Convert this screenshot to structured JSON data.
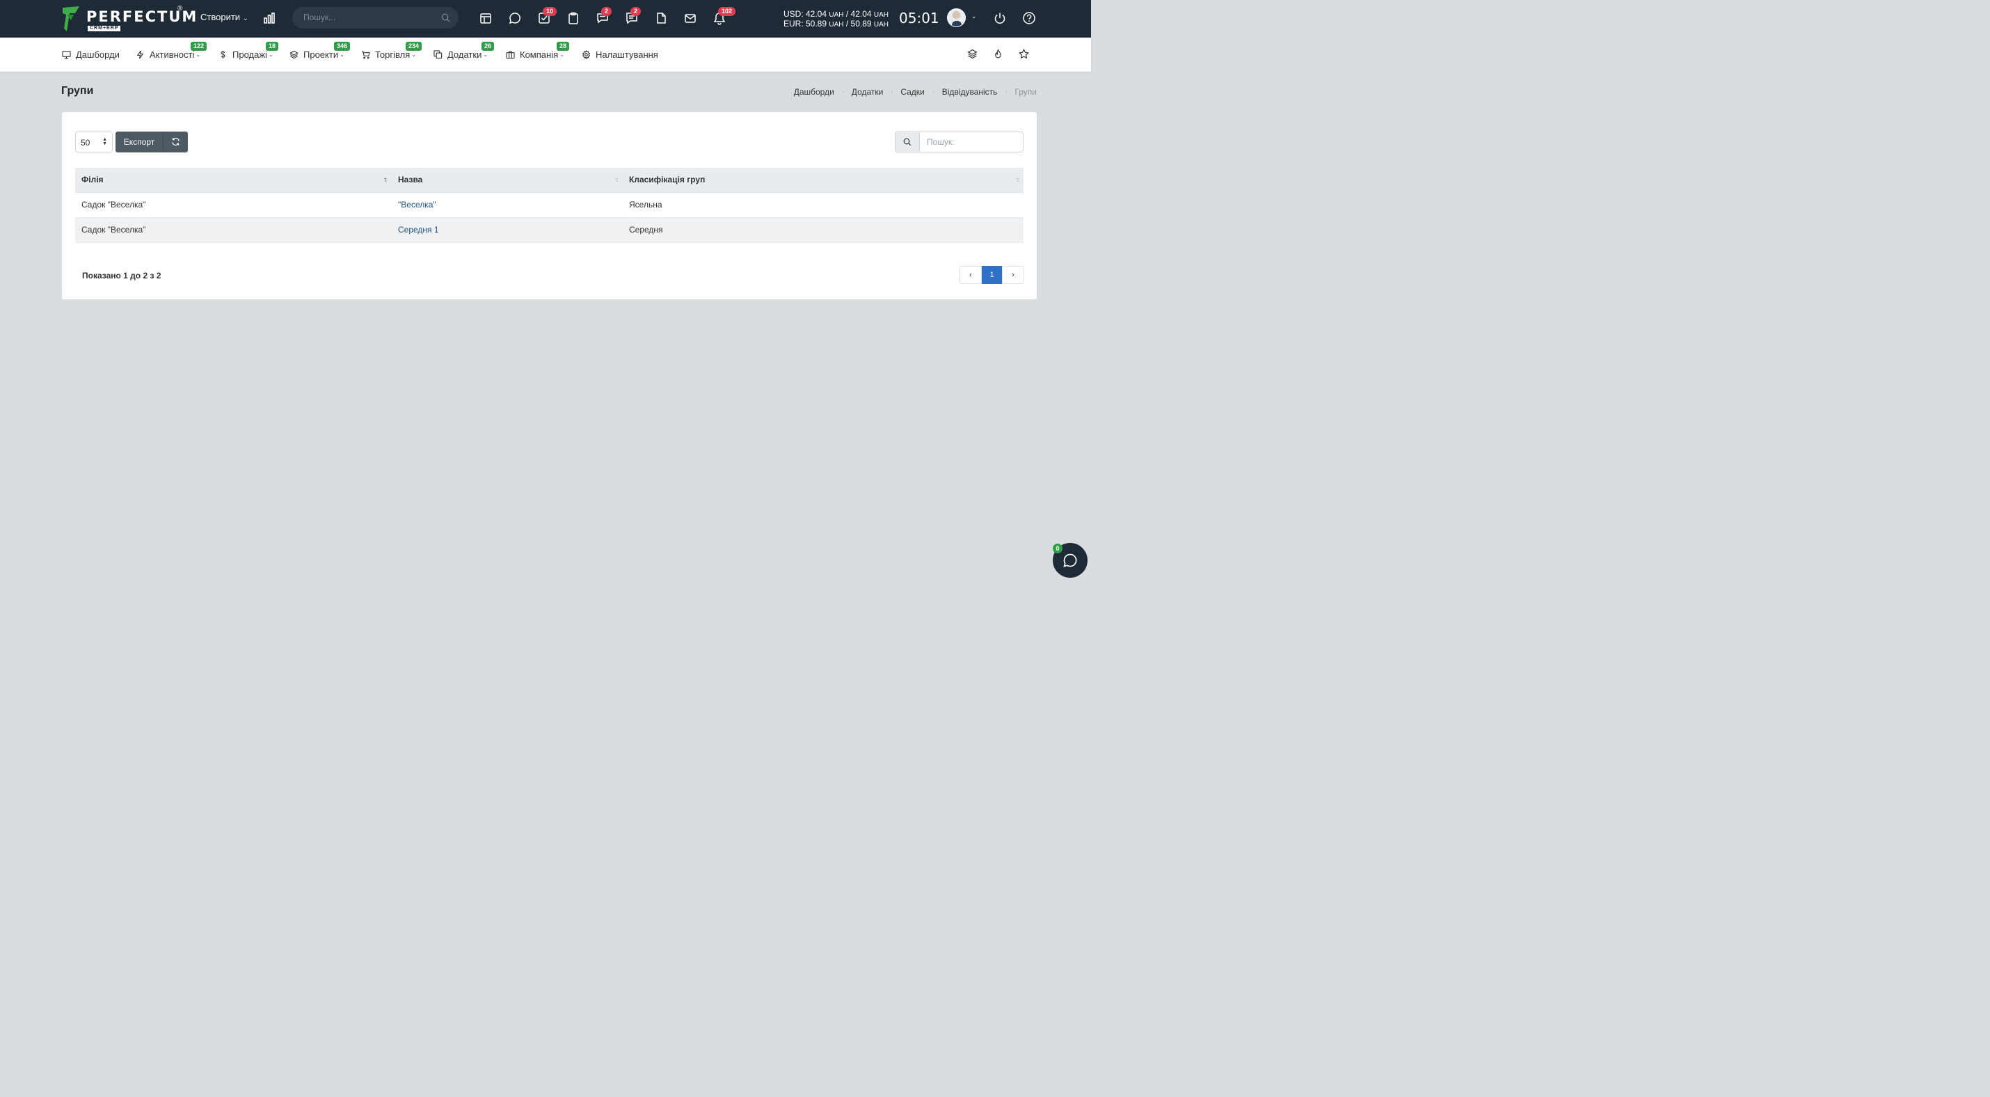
{
  "header": {
    "logo_text": "PERFECTUM",
    "logo_sub": "CRM+ERP",
    "logo_reg": "®",
    "create_label": "Створити",
    "search_placeholder": "Пошук...",
    "icons": [
      {
        "name": "calendar-icon",
        "badge": ""
      },
      {
        "name": "chat-icon",
        "badge": ""
      },
      {
        "name": "tasks-icon",
        "badge": "10"
      },
      {
        "name": "clipboard-icon",
        "badge": ""
      },
      {
        "name": "discussions-icon",
        "badge": "2"
      },
      {
        "name": "notes-icon",
        "badge": "2"
      },
      {
        "name": "file-icon",
        "badge": ""
      },
      {
        "name": "mail-icon",
        "badge": ""
      },
      {
        "name": "bell-icon",
        "badge": "102"
      }
    ],
    "usd_line": "USD: 42.04",
    "usd_mid": "/ 42.04",
    "eur_line": "EUR: 50.89",
    "eur_mid": "/ 50.89",
    "currency_unit": "UAH",
    "clock": "05:01"
  },
  "nav": {
    "items": [
      {
        "label": "Дашборди",
        "icon": "monitor-icon",
        "badge": ""
      },
      {
        "label": "Активності",
        "icon": "bolt-icon",
        "badge": "122"
      },
      {
        "label": "Продажі",
        "icon": "dollar-icon",
        "badge": "18"
      },
      {
        "label": "Проекти",
        "icon": "layers-icon",
        "badge": "346"
      },
      {
        "label": "Торгівля",
        "icon": "cart-icon",
        "badge": "234"
      },
      {
        "label": "Додатки",
        "icon": "copy-icon",
        "badge": "26"
      },
      {
        "label": "Компанія",
        "icon": "briefcase-icon",
        "badge": "28"
      },
      {
        "label": "Налаштування",
        "icon": "gear-icon",
        "badge": ""
      }
    ]
  },
  "page": {
    "title": "Групи",
    "breadcrumbs": [
      "Дашборди",
      "Додатки",
      "Садки",
      "Відвідуваність",
      "Групи"
    ]
  },
  "table_controls": {
    "page_length": "50",
    "export_label": "Експорт",
    "search_placeholder": "Пошук:"
  },
  "table": {
    "columns": [
      "Філія",
      "Назва",
      "Класифікація груп"
    ],
    "rows": [
      [
        "Садок \"Веселка\"",
        "\"Веселка\"",
        "Ясельна"
      ],
      [
        "Садок \"Веселка\"",
        "Середня 1",
        "Середня"
      ]
    ],
    "info": "Показано 1 до 2 з 2",
    "current_page": "1",
    "prev": "‹",
    "next": "›"
  },
  "chat": {
    "badge": "0"
  },
  "colors": {
    "topbar": "#1e2a35",
    "accent": "#2e6fc7",
    "badge_red": "#e03c52",
    "badge_green": "#2e9e47"
  }
}
